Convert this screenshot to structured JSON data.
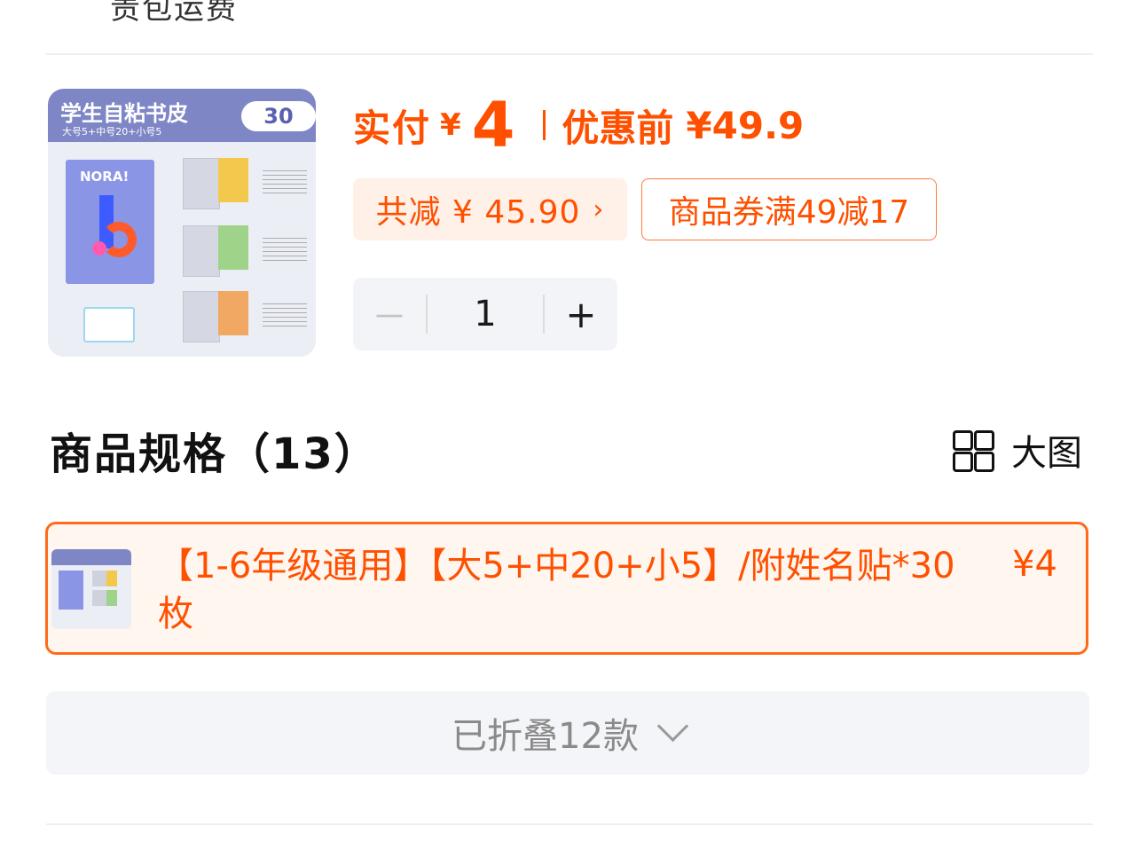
{
  "shipping": {
    "text": "责包运费"
  },
  "product": {
    "image": {
      "title": "学生自粘书皮",
      "subtitle": "大号5+中号20+小号5",
      "badge": "30",
      "book_brand": "NORA!"
    },
    "price": {
      "pay_label": "实付",
      "currency": "¥",
      "pay_amount": "4",
      "before_label": "优惠前",
      "before_amount": "¥49.9"
    },
    "discount": {
      "reduce_text": "共减 ¥ 45.90",
      "chevron": "›"
    },
    "coupon": {
      "text": "商品券满49减17"
    },
    "quantity": {
      "minus": "－",
      "value": "1",
      "plus": "+"
    }
  },
  "specs": {
    "title": "商品规格（13）",
    "big_picture_label": "大图",
    "big_picture_icon": "grid-icon",
    "selected_variant": {
      "name": "【1-6年级通用】【大5+中20+小5】/附姓名贴*30枚",
      "price": "¥4"
    },
    "collapsed_text": "已折叠12款",
    "collapsed_icon": "chevron-down-icon"
  },
  "colors": {
    "accent": "#ff5000",
    "accent_light_bg": "#fff0e8",
    "stepper_bg": "#f3f4f7"
  }
}
